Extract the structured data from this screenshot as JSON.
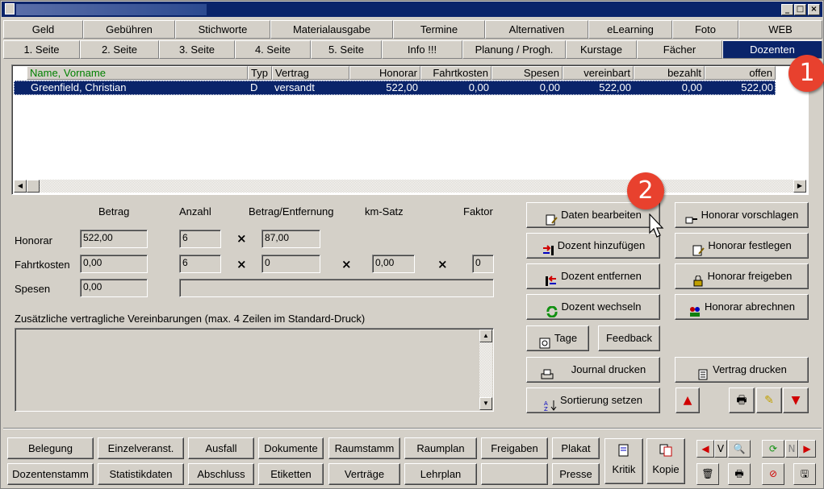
{
  "window": {
    "minimize": "_",
    "maximize": "□",
    "close": "×"
  },
  "tabs_row1": [
    "Geld",
    "Gebühren",
    "Stichworte",
    "Materialausgabe",
    "Termine",
    "Alternativen",
    "eLearning",
    "Foto",
    "WEB"
  ],
  "tabs_row2": [
    "1. Seite",
    "2. Seite",
    "3. Seite",
    "4. Seite",
    "5. Seite",
    "Info !!!",
    "Planung / Progh.",
    "Kurstage",
    "Fächer",
    "Dozenten"
  ],
  "table": {
    "columns": [
      "Name, Vorname",
      "Typ",
      "Vertrag",
      "Honorar",
      "Fahrtkosten",
      "Spesen",
      "vereinbart",
      "bezahlt",
      "offen"
    ],
    "rows": [
      [
        "Greenfield, Christian",
        "D",
        "versandt",
        "522,00",
        "0,00",
        "0,00",
        "522,00",
        "0,00",
        "522,00"
      ]
    ]
  },
  "form": {
    "col_betrag": "Betrag",
    "col_anzahl": "Anzahl",
    "col_betrag_entf": "Betrag/Entfernung",
    "col_kmsatz": "km-Satz",
    "col_faktor": "Faktor",
    "honorar_label": "Honorar",
    "honorar_betrag": "522,00",
    "honorar_anzahl": "6",
    "honorar_betrag_entf": "87,00",
    "fahrtkosten_label": "Fahrtkosten",
    "fahrtkosten_betrag": "0,00",
    "fahrtkosten_anzahl": "6",
    "fahrtkosten_betrag_entf": "0",
    "fahrtkosten_kmsatz": "0,00",
    "fahrtkosten_faktor": "0",
    "spesen_label": "Spesen",
    "spesen_betrag": "0,00",
    "times": "×",
    "zusatz_label": "Zusätzliche vertragliche Vereinbarungen  (max. 4 Zeilen im Standard-Druck)"
  },
  "actions": {
    "daten_bearbeiten": "Daten bearbeiten",
    "dozent_hinzufuegen": "Dozent hinzufügen",
    "dozent_entfernen": "Dozent entfernen",
    "dozent_wechseln": "Dozent wechseln",
    "tage": "Tage",
    "feedback": "Feedback",
    "journal_drucken": "Journal drucken",
    "sortierung_setzen": "Sortierung setzen",
    "honorar_vorschlagen": "Honorar vorschlagen",
    "honorar_festlegen": "Honorar festlegen",
    "honorar_freigeben": "Honorar freigeben",
    "honorar_abrechnen": "Honorar abrechnen",
    "vertrag_drucken": "Vertrag drucken"
  },
  "bottom": {
    "row1": [
      "Belegung",
      "Einzelveranst.",
      "Ausfall",
      "Dokumente",
      "Raumstamm",
      "Raumplan",
      "Freigaben",
      "Plakat"
    ],
    "row2": [
      "Dozentenstamm",
      "Statistikdaten",
      "Abschluss",
      "Etiketten",
      "Verträge",
      "Lehrplan",
      "",
      "Presse"
    ],
    "kritik": "Kritik",
    "kopie": "Kopie",
    "nav_v": "V",
    "nav_n": "N"
  },
  "badges": [
    "1",
    "2"
  ],
  "colors": {
    "title_bar": "#0a246a",
    "selection": "#0a246a",
    "header_green": "#008000",
    "badge_red": "#e8412e",
    "face": "#d4d0c8"
  }
}
